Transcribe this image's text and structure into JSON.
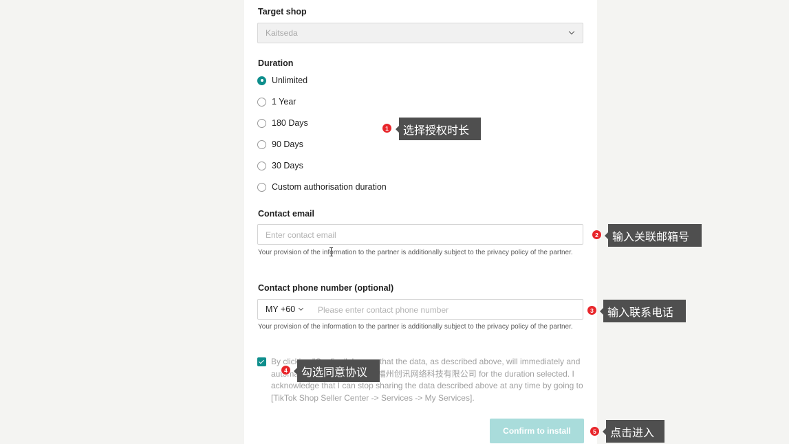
{
  "form": {
    "target_shop": {
      "label": "Target shop",
      "value": "Kaitseda"
    },
    "duration": {
      "label": "Duration",
      "options": [
        {
          "label": "Unlimited",
          "selected": true
        },
        {
          "label": "1 Year",
          "selected": false
        },
        {
          "label": "180 Days",
          "selected": false
        },
        {
          "label": "90 Days",
          "selected": false
        },
        {
          "label": "30 Days",
          "selected": false
        },
        {
          "label": "Custom authorisation duration",
          "selected": false
        }
      ]
    },
    "contact_email": {
      "label": "Contact email",
      "placeholder": "Enter contact email",
      "value": "",
      "note": "Your provision of the information to the partner is additionally subject to the privacy policy of the partner."
    },
    "contact_phone": {
      "label": "Contact phone number (optional)",
      "country_code": "MY +60",
      "placeholder": "Please enter contact phone number",
      "value": "",
      "note": "Your provision of the information to the partner is additionally subject to the privacy policy of the partner."
    },
    "consent": {
      "checked": true,
      "text": "By clicking \"Confirm\", I agree that the data, as described above, will immediately and automatically be shared with 福州创讯网络科技有限公司 for the duration selected. I acknowledge that I can stop sharing the data described above at any time by going to [TikTok Shop Seller Center -> Services -> My Services]."
    },
    "confirm_button": {
      "label": "Confirm to install",
      "enabled": false
    }
  },
  "annotations": [
    {
      "number": "1",
      "text": "选择授权时长"
    },
    {
      "number": "2",
      "text": "输入关联邮箱号"
    },
    {
      "number": "3",
      "text": "输入联系电话"
    },
    {
      "number": "4",
      "text": "勾选同意协议"
    },
    {
      "number": "5",
      "text": "点击进入"
    }
  ],
  "colors": {
    "accent": "#0e8e8c",
    "button_disabled": "#a9dcdb",
    "badge": "#e8262b",
    "callout_bg": "#4f4f4f",
    "page_bg": "#f4f4f2"
  }
}
